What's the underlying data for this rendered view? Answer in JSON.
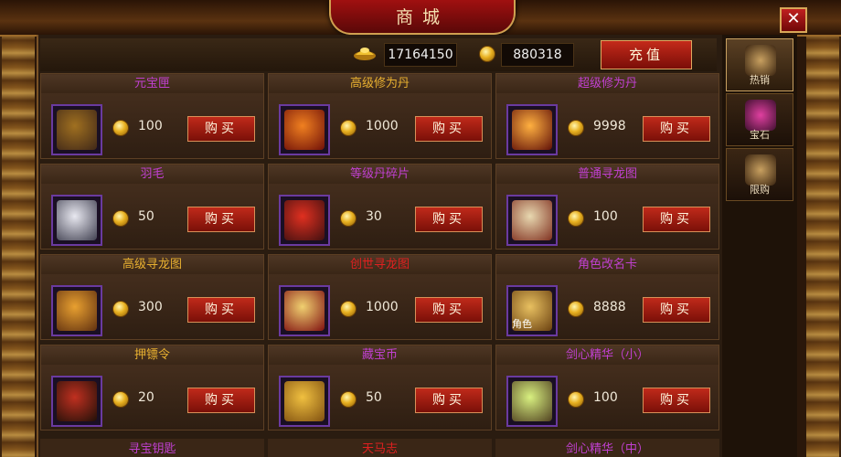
{
  "window": {
    "title": "商城",
    "close_label": "✕"
  },
  "currency": {
    "ingot_icon": "gold-ingot-icon",
    "ingots": "17164150",
    "coin_icon": "gold-coin-icon",
    "coins": "880318",
    "recharge_label": "充值"
  },
  "tabs": [
    {
      "label": "热销",
      "icon": "hot-sale-icon",
      "active": true
    },
    {
      "label": "宝石",
      "icon": "gem-icon",
      "active": false
    },
    {
      "label": "限购",
      "icon": "limited-gift-icon",
      "active": false
    }
  ],
  "items": [
    {
      "name": "元宝匣",
      "name_color": "#c040d0",
      "price": "100",
      "buy_label": "购买",
      "icon": "treasure-chest-icon",
      "art": [
        "#a07020",
        "#402818"
      ]
    },
    {
      "name": "高级修为丹",
      "name_color": "#e8b030",
      "price": "1000",
      "buy_label": "购买",
      "icon": "fire-pill-icon",
      "art": [
        "#f08020",
        "#701008"
      ]
    },
    {
      "name": "超级修为丹",
      "name_color": "#c040d0",
      "price": "9998",
      "buy_label": "购买",
      "icon": "swirl-pill-icon",
      "art": [
        "#ffb040",
        "#601008"
      ]
    },
    {
      "name": "羽毛",
      "name_color": "#c040d0",
      "price": "50",
      "buy_label": "购买",
      "icon": "feather-icon",
      "art": [
        "#e8e8f0",
        "#404050"
      ]
    },
    {
      "name": "等级丹碎片",
      "name_color": "#c040d0",
      "price": "30",
      "buy_label": "购买",
      "icon": "pill-fragment-icon",
      "art": [
        "#e03020",
        "#401010"
      ]
    },
    {
      "name": "普通寻龙图",
      "name_color": "#c040d0",
      "price": "100",
      "buy_label": "购买",
      "icon": "scroll-map-icon",
      "art": [
        "#e8d8b0",
        "#803020"
      ]
    },
    {
      "name": "高级寻龙图",
      "name_color": "#e8b030",
      "price": "300",
      "buy_label": "购买",
      "icon": "golden-scroll-icon",
      "art": [
        "#e8a030",
        "#603010"
      ]
    },
    {
      "name": "创世寻龙图",
      "name_color": "#e02020",
      "price": "1000",
      "buy_label": "购买",
      "icon": "lightning-scroll-icon",
      "art": [
        "#f0d070",
        "#801010"
      ]
    },
    {
      "name": "角色改名卡",
      "name_color": "#c040d0",
      "price": "8888",
      "buy_label": "购买",
      "icon": "rename-card-icon",
      "art": [
        "#e8c060",
        "#6a4010"
      ],
      "overlay": "角色"
    },
    {
      "name": "押镖令",
      "name_color": "#e8b030",
      "price": "20",
      "buy_label": "购买",
      "icon": "escort-token-icon",
      "art": [
        "#c03020",
        "#201008"
      ]
    },
    {
      "name": "藏宝币",
      "name_color": "#c040d0",
      "price": "50",
      "buy_label": "购买",
      "icon": "treasure-coin-icon",
      "art": [
        "#f0c040",
        "#805010"
      ]
    },
    {
      "name": "剑心精华（小）",
      "name_color": "#c040d0",
      "price": "100",
      "buy_label": "购买",
      "icon": "crystal-icon",
      "art": [
        "#d8f080",
        "#504020"
      ]
    }
  ],
  "partial_items": [
    {
      "name": "寻宝钥匙",
      "name_color": "#c040d0"
    },
    {
      "name": "天马志",
      "name_color": "#e02020"
    },
    {
      "name": "剑心精华（中）",
      "name_color": "#c040d0"
    }
  ]
}
